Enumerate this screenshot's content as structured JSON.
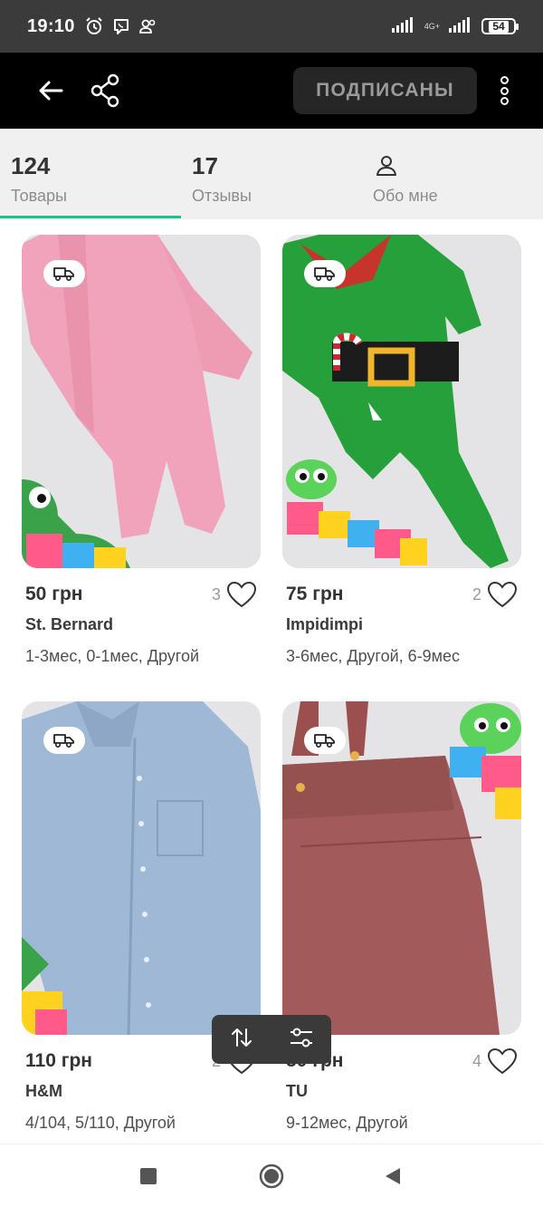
{
  "status_bar": {
    "time": "19:10",
    "network": "4G+",
    "battery": "54"
  },
  "header": {
    "subscribe_label": "ПОДПИСАНЫ"
  },
  "tabs": [
    {
      "count": "124",
      "label": "Товары",
      "active": true
    },
    {
      "count": "17",
      "label": "Отзывы",
      "active": false
    },
    {
      "count": "",
      "label": "Обо мне",
      "active": false
    }
  ],
  "products": [
    {
      "price": "50 грн",
      "likes": "3",
      "brand": "St. Bernard",
      "sizes": "1-3мес, 0-1мес, Другой",
      "image": "pink-baby-sleeper"
    },
    {
      "price": "75 грн",
      "likes": "2",
      "brand": "Impidimpi",
      "sizes": "3-6мес, Другой, 6-9мес",
      "image": "green-elf-sleeper"
    },
    {
      "price": "110 грн",
      "likes": "2",
      "brand": "H&M",
      "sizes": "4/104, 5/110, Другой",
      "image": "blue-shirt"
    },
    {
      "price": "50 грн",
      "likes": "4",
      "brand": "TU",
      "sizes": "9-12мес, Другой",
      "image": "rose-corduroy-dress"
    }
  ],
  "colors": {
    "accent": "#19c38f",
    "app_bar": "#000000",
    "status_bar": "#3b3b3b"
  }
}
